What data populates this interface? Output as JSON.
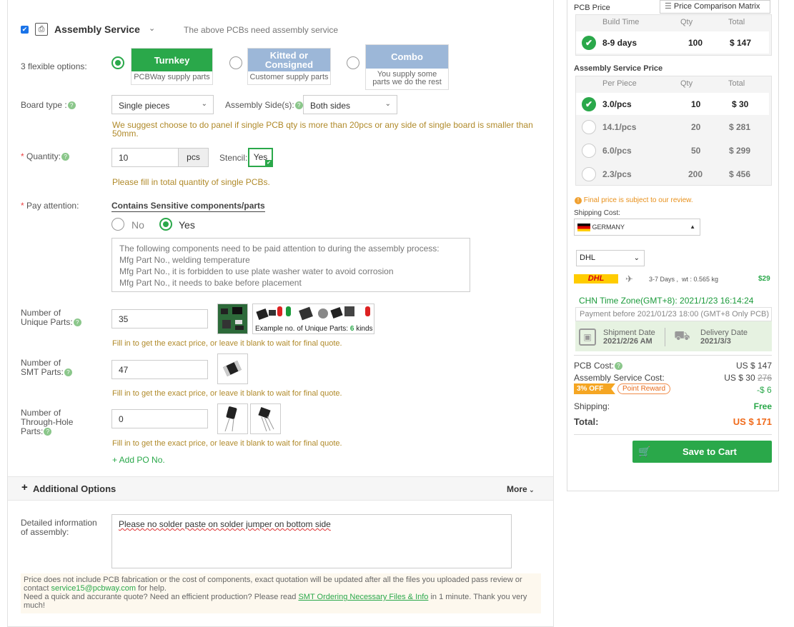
{
  "assembly": {
    "title": "Assembly Service",
    "note": "The above PCBs need assembly service",
    "options_label": "3 flexible options:",
    "options": [
      {
        "title": "Turnkey",
        "desc": "PCBWay supply parts",
        "color": "#2aa84a",
        "selected": true
      },
      {
        "title": "Kitted or Consigned",
        "desc": "Customer supply parts",
        "color": "#9cb7d8",
        "selected": false
      },
      {
        "title": "Combo",
        "desc": "You supply some parts we do the rest",
        "color": "#9cb7d8",
        "selected": false
      }
    ],
    "board_type_label": "Board type :",
    "board_type": "Single pieces",
    "assembly_side_label": "Assembly Side(s):",
    "assembly_side": "Both sides",
    "panel_warning": "We suggest choose to do panel if single PCB qty is more than 20pcs or any side of single board is smaller than 50mm.",
    "quantity_label": "Quantity:",
    "quantity": "10",
    "quantity_unit": "pcs",
    "stencil_label": "Stencil:",
    "stencil_value": "Yes",
    "quantity_hint": "Please fill in total quantity of single PCBs.",
    "pay_attention_label": "Pay attention:",
    "sensitive_title": "Contains Sensitive components/parts",
    "sensitive_no": "No",
    "sensitive_yes": "Yes",
    "sensitive_text": [
      "The following components need to be paid attention to during the assembly process:",
      "Mfg Part No., welding temperature",
      "Mfg Part No., it is forbidden to use plate washer water to avoid corrosion",
      "Mfg Part No., it needs to bake before placement"
    ],
    "unique_label_1": "Number of",
    "unique_label_2": "Unique Parts:",
    "unique_parts": "35",
    "unique_example_prefix": "Example no. of Unique Parts:",
    "unique_example_count": "6",
    "unique_example_suffix": "kinds",
    "smt_label_1": "Number of",
    "smt_label_2": "SMT Parts:",
    "smt_parts": "47",
    "th_label_1": "Number of",
    "th_label_2": "Through-Hole",
    "th_label_3": "Parts:",
    "th_parts": "0",
    "fill_hint": "Fill in to get the exact price, or leave it blank to wait for final quote.",
    "add_po": "+ Add PO No.",
    "additional_options": "Additional Options",
    "more": "More",
    "detail_label_1": "Detailed information",
    "detail_label_2": "of assembly:",
    "detail_text": "Please no solder paste on solder jumper on bottom side",
    "notice_1": "Price does not include PCB fabrication or the cost of components, exact quotation will be updated after all the files you uploaded pass review or",
    "notice_2a": "contact ",
    "notice_email": "service15@pcbway.com",
    "notice_2b": " for help.",
    "notice_3a": "Need a quick and accurante quote? Need an efficient production? Please read ",
    "notice_link": "SMT Ordering Necessary Files & Info",
    "notice_3b": " in 1 minute. Thank you very",
    "notice_4": "much!"
  },
  "sidebar": {
    "pcb_price_label": "PCB Price",
    "matrix_button": "Price Comparison Matrix",
    "pcb_headers": [
      "Build Time",
      "Qty",
      "Total"
    ],
    "pcb_row": {
      "build_time": "8-9 days",
      "qty": "100",
      "total": "$ 147"
    },
    "asm_price_label": "Assembly Service Price",
    "asm_headers": [
      "Per Piece",
      "Qty",
      "Total"
    ],
    "asm_rows": [
      {
        "per_piece": "3.0/pcs",
        "qty": "10",
        "total": "$ 30",
        "selected": true
      },
      {
        "per_piece": "14.1/pcs",
        "qty": "20",
        "total": "$ 281",
        "selected": false
      },
      {
        "per_piece": "6.0/pcs",
        "qty": "50",
        "total": "$ 299",
        "selected": false
      },
      {
        "per_piece": "2.3/pcs",
        "qty": "200",
        "total": "$ 456",
        "selected": false
      }
    ],
    "review_note": "Final price is subject to our review.",
    "shipping_cost_label": "Shipping Cost:",
    "country": "GERMANY",
    "carrier": "DHL",
    "carrier_logo": "DHL",
    "ship_days": "3-7 Days ,",
    "ship_wt": "wt : 0.565 kg",
    "ship_price": "$29",
    "timezone": "CHN Time Zone(GMT+8): 2021/1/23 16:14:24",
    "payment_before": "Payment before 2021/01/23 18:00 (GMT+8 Only PCB)",
    "shipment_label": "Shipment Date",
    "shipment_date": "2021/2/26 AM",
    "delivery_label": "Delivery Date",
    "delivery_date": "2021/3/3",
    "pcb_cost_label": "PCB Cost:",
    "pcb_cost": "US $ 147",
    "asm_cost_label": "Assembly Service Cost:",
    "asm_cost": "US $ 30",
    "asm_cost_old": "276",
    "discount_badge": "3% OFF",
    "point_reward": "Point Reward",
    "discount_value": "-$ 6",
    "shipping_label": "Shipping:",
    "shipping_value": "Free",
    "total_label": "Total:",
    "total_value": "US $ 171",
    "save_cart": "Save to Cart"
  }
}
